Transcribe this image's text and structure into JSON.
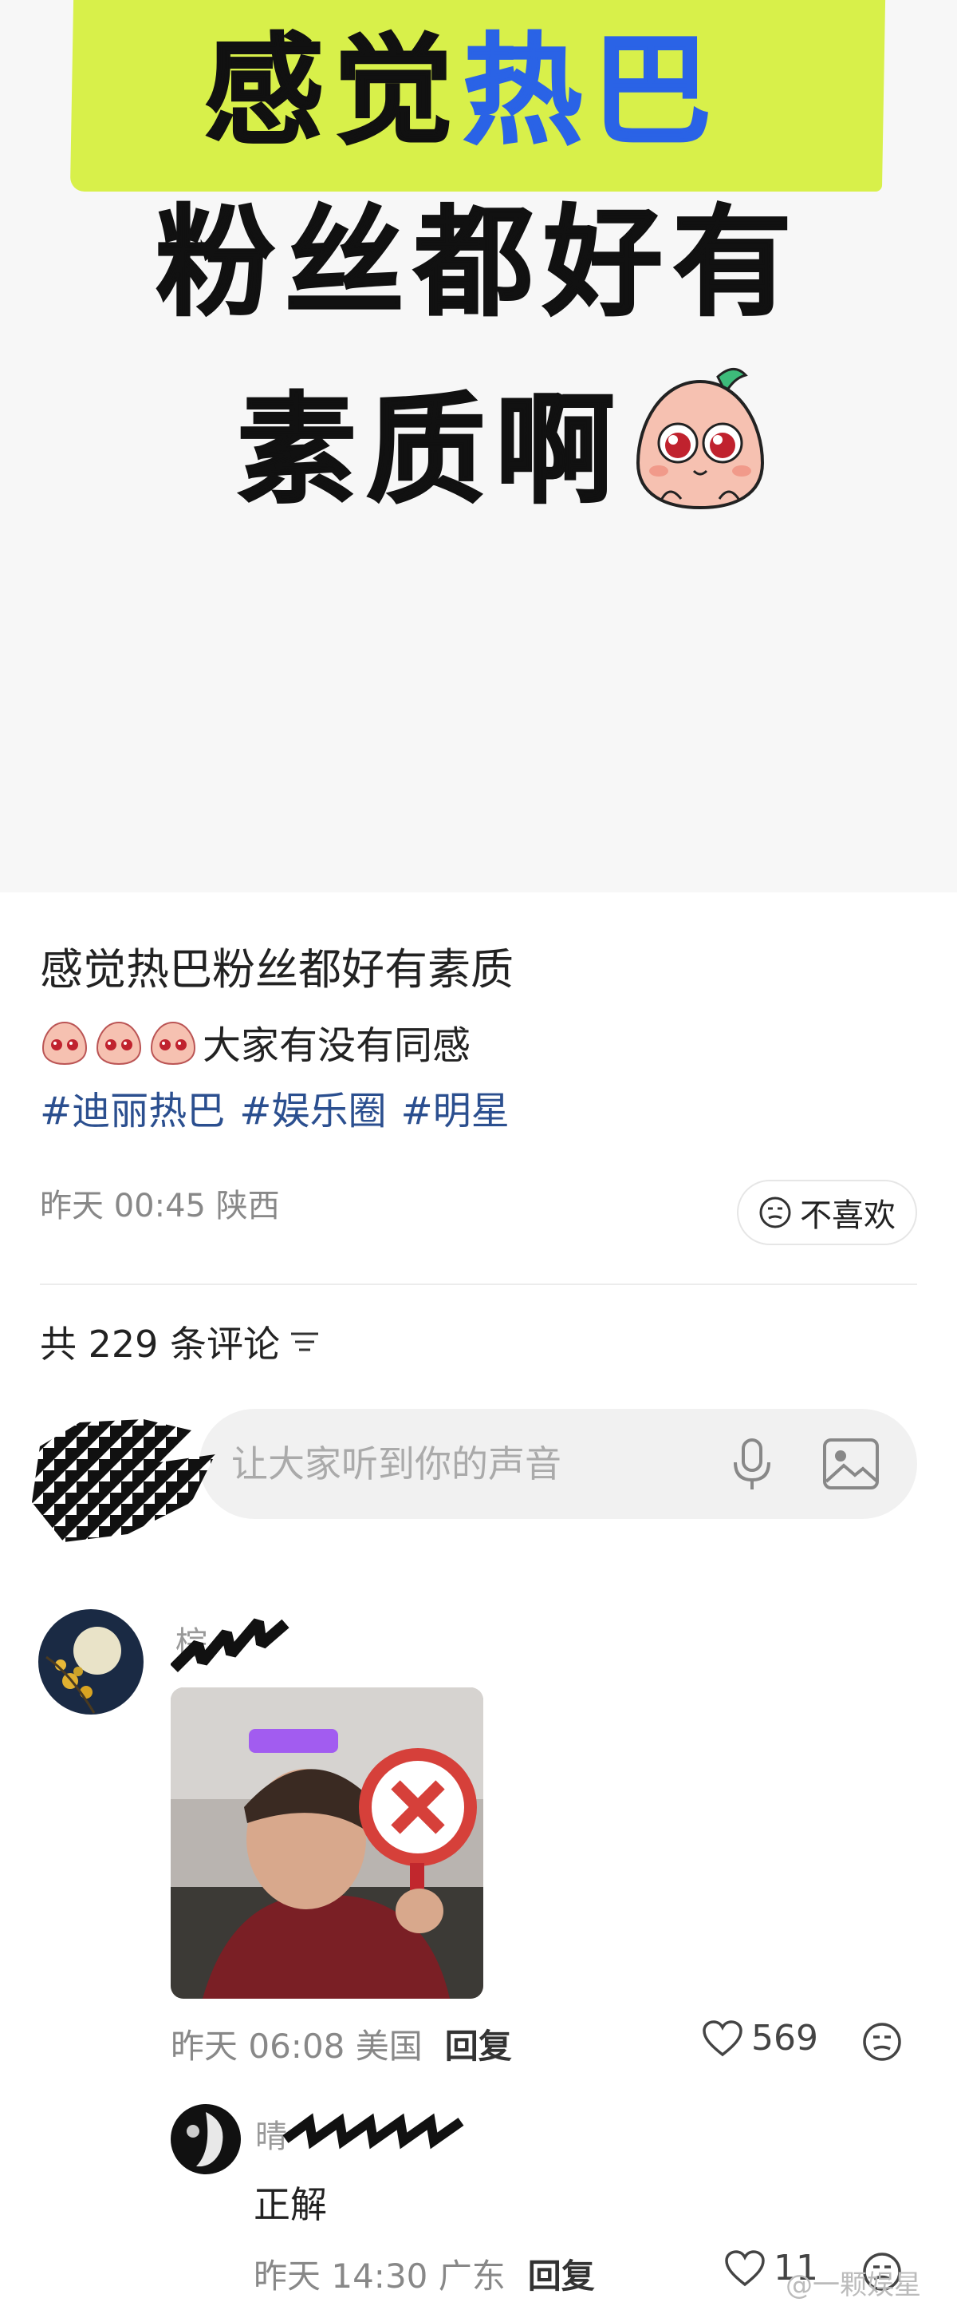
{
  "hero": {
    "line1_a": "感觉",
    "line1_b": "热巴",
    "line2": "粉丝都好有",
    "line3": "素质啊",
    "accent_color": "#2a63e6",
    "highlight_color": "#d8f04a"
  },
  "post": {
    "title": "感觉热巴粉丝都好有素质",
    "body_text": "大家有没有同感",
    "tags": [
      "#迪丽热巴",
      "#娱乐圈",
      "#明星"
    ],
    "time": "昨天 00:45 陕西",
    "dislike_label": "不喜欢"
  },
  "comments_header": {
    "count_text": "共 229 条评论"
  },
  "comment_input": {
    "placeholder": "让大家听到你的声音"
  },
  "comments": [
    {
      "name_visible": "棕",
      "time": "昨天 06:08 美国",
      "reply_label": "回复",
      "likes": "569"
    },
    {
      "name_visible": "晴",
      "text": "正解",
      "time": "昨天 14:30 广东",
      "reply_label": "回复",
      "likes": "11"
    }
  ],
  "watermark": "@一颗娱星"
}
